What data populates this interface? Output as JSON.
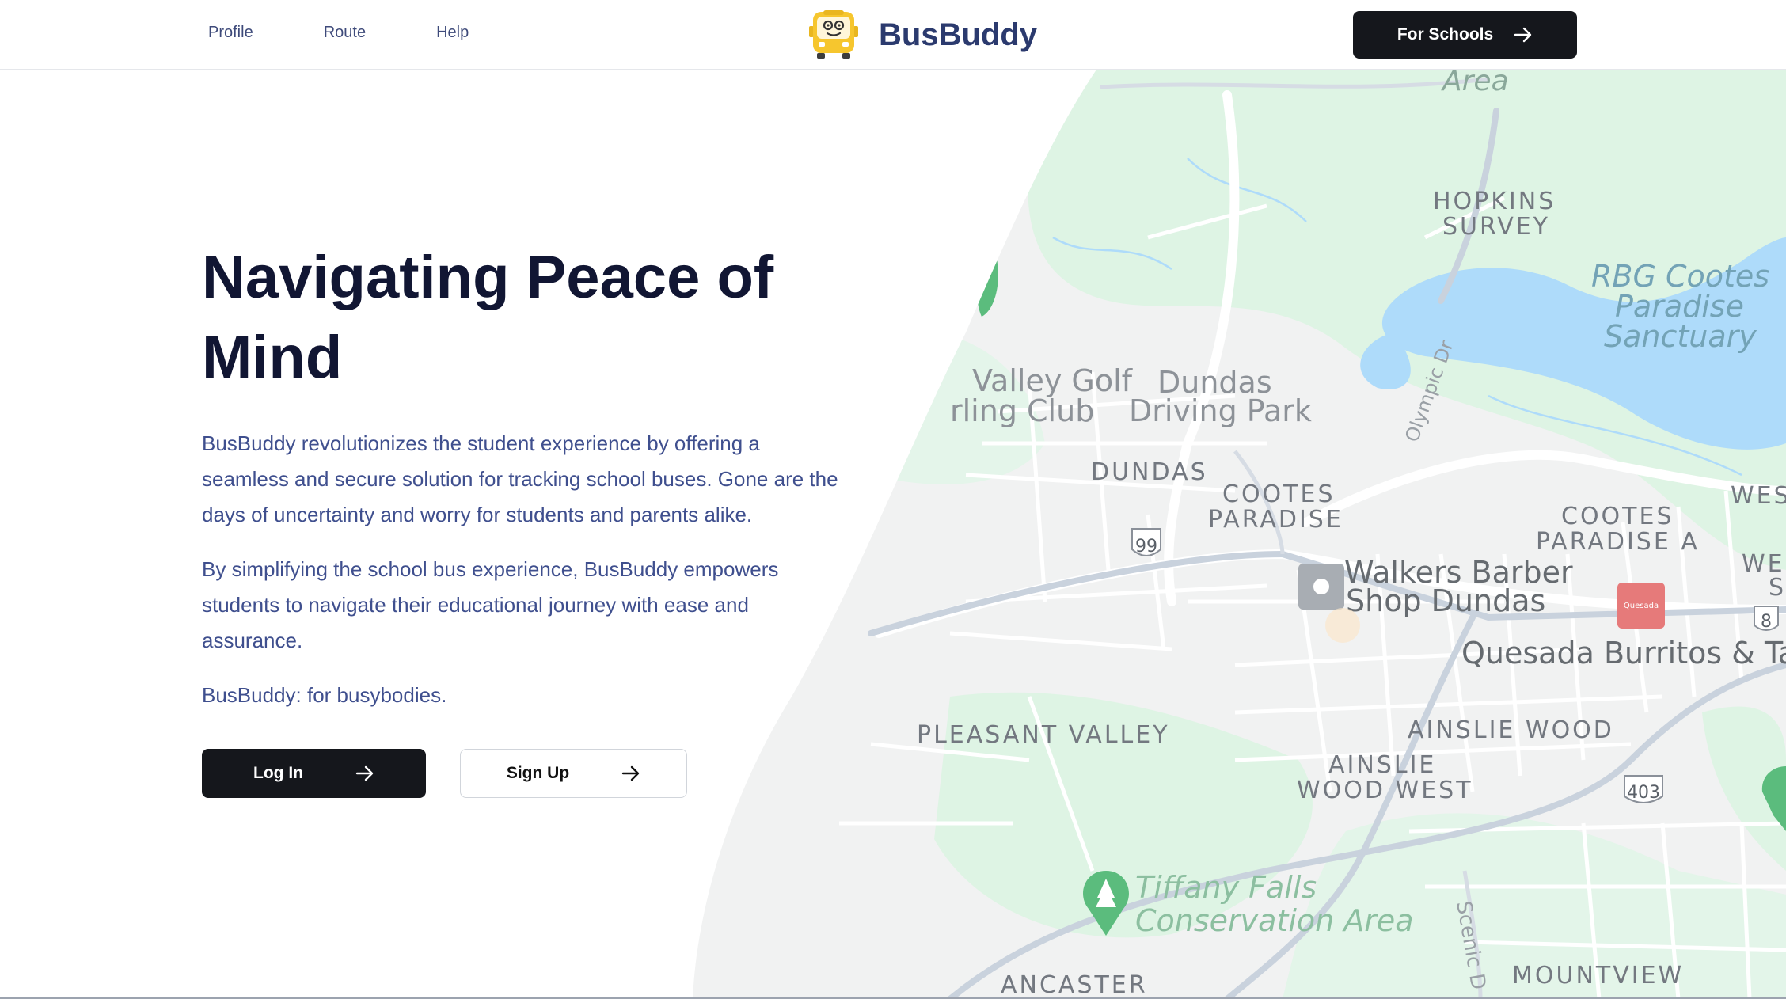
{
  "nav": {
    "items": [
      "Profile",
      "Route",
      "Help"
    ]
  },
  "brand": {
    "name": "BusBuddy",
    "logo_icon": "bus-face-icon",
    "logo_color": "#f6c62e"
  },
  "header_cta": {
    "label": "For Schools",
    "icon": "arrow-right-icon"
  },
  "hero": {
    "title_line1": "Navigating Peace of",
    "title_line2": "Mind",
    "paragraph1": "BusBuddy revolutionizes the student experience by offering a seamless and secure solution for tracking school buses. Gone are the days of uncertainty and worry for students and parents alike.",
    "paragraph2": "By simplifying the school bus experience, BusBuddy empowers students to navigate their educational journey with ease and assurance.",
    "tagline": "BusBuddy: for busybodies."
  },
  "actions": {
    "login_label": "Log In",
    "signup_label": "Sign Up"
  },
  "map": {
    "labels": {
      "area": "Area",
      "hopkins1": "HOPKINS",
      "hopkins2": "SURVEY",
      "rbg1": "RBG Cootes",
      "rbg2": "Paradise",
      "rbg3": "Sanctuary",
      "valley_golf": "Valley Golf",
      "curling": "rling Club",
      "dundas_drive1": "Dundas",
      "dundas_drive2": "Driving Park",
      "olympic": "Olympic Dr",
      "dundas": "DUNDAS",
      "cootes1": "COOTES",
      "cootes2": "PARADISE",
      "cootes_a1": "COOTES",
      "cootes_a2": "PARADISE A",
      "wes": "WES",
      "we": "WE",
      "s": "S",
      "hwy99": "99",
      "hwy8": "8",
      "walkers1": "Walkers Barber",
      "walkers2": "Shop Dundas",
      "quesada": "Quesada Burritos & Tac",
      "quesada_pin": "Quesada",
      "ainslie_wood": "AINSLIE WOOD",
      "ainslie_west1": "AINSLIE",
      "ainslie_west2": "WOOD WEST",
      "pleasant": "PLEASANT VALLEY",
      "hwy403": "403",
      "tiffany1": "Tiffany Falls",
      "tiffany2": "Conservation Area",
      "scenic": "Scenic D",
      "ancaster": "ANCASTER",
      "mountview": "MOUNTVIEW"
    },
    "colors": {
      "land": "#f3f4f4",
      "park": "#def5e6",
      "water": "#aadaff",
      "road": "#ffffff",
      "highway": "#c4cdd9",
      "label": "#6b7076",
      "poi_green": "#5bbc7d"
    }
  }
}
